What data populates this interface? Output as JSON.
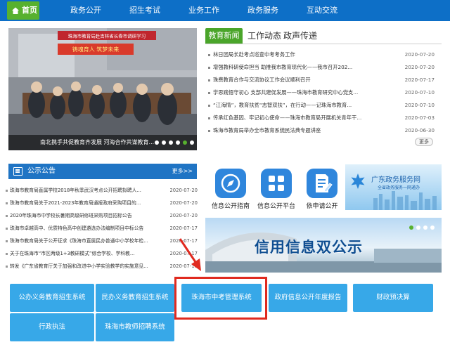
{
  "nav": {
    "home": "首页",
    "items": [
      "政务公开",
      "招生考试",
      "业务工作",
      "政务服务",
      "互动交流"
    ]
  },
  "slider": {
    "banner_text": "珠海市教育局赴吉林省长春市调研学习",
    "sign_text": "铸魂育人 筑梦未来",
    "caption": "南北携手共促教育齐发展 河海合作共谋教育..."
  },
  "news": {
    "tabs": [
      "教育新闻",
      "工作动态",
      "政声传递"
    ],
    "items": [
      {
        "title": "林日团局长赴考点巡查中考考务工作",
        "date": "2020-07-20"
      },
      {
        "title": "增强教科研使命担当 助推我市教育现代化——我市召开202...",
        "date": "2020-07-20"
      },
      {
        "title": "珠费教育合作与交流协议工作会议顺利召开",
        "date": "2020-07-17"
      },
      {
        "title": "学思践悟守初心 支部共建促发展——珠海市教育研究中心党支...",
        "date": "2020-07-10"
      },
      {
        "title": "“江海情”，教育扶贫“志智双扶”，在行动——记珠海市教育...",
        "date": "2020-07-10"
      },
      {
        "title": "传承红色基因、牢记初心使命——珠海市教育局开展机关青年干...",
        "date": "2020-07-03"
      },
      {
        "title": "珠海市教育局举办全市教育系统民法典专题讲座",
        "date": "2020-06-30"
      }
    ],
    "more": "更多"
  },
  "notice": {
    "title": "公示公告",
    "more": "更多>>",
    "items": [
      {
        "title": "珠海市教育局直属学校2018年秋季武汉考点公开招聘拟聘人...",
        "date": "2020-07-20"
      },
      {
        "title": "珠海市教育局关于2021-2023年教育局通报政府采购项目的...",
        "date": "2020-07-20"
      },
      {
        "title": "2020年珠海市中学校长暑期高级研修班采购项目招标公告",
        "date": "2020-07-20"
      },
      {
        "title": "珠海市卓越高中、优质特色高中创建遴选办法编制项目中标公告",
        "date": "2020-07-17"
      },
      {
        "title": "珠海市教育局关于公开征求《珠海市直属民办普通中小学校年检...",
        "date": "2020-07-17"
      },
      {
        "title": "关于在珠海市“市区两级1+3教研模式”综合学校、学科教...",
        "date": "2020-07-17"
      },
      {
        "title": "转发《广东省教育厅关于加强和改进中小学实验教学的实施意见...",
        "date": "2020-07-16"
      }
    ]
  },
  "quick": [
    {
      "label": "信息公开指南",
      "icon": "compass-icon"
    },
    {
      "label": "信息公开平台",
      "icon": "grid-apps-icon"
    },
    {
      "label": "依申请公开",
      "icon": "document-edit-icon"
    }
  ],
  "gd_banner": {
    "title": "广东政务服务网",
    "subtitle": "全省政务服务一网通办"
  },
  "info_banner": {
    "text": "信用信息双公示"
  },
  "systems": [
    "公办义务教育招生系统",
    "民办义务教育招生系统",
    "珠海市中考管理系统",
    "政府信息公开年度报告",
    "财政预决算",
    "行政执法",
    "珠海市教师招聘系统"
  ],
  "colors": {
    "nav": "#0d6fc7",
    "green": "#57b12f",
    "button": "#37a8e8",
    "highlight": "#e02a1f"
  }
}
